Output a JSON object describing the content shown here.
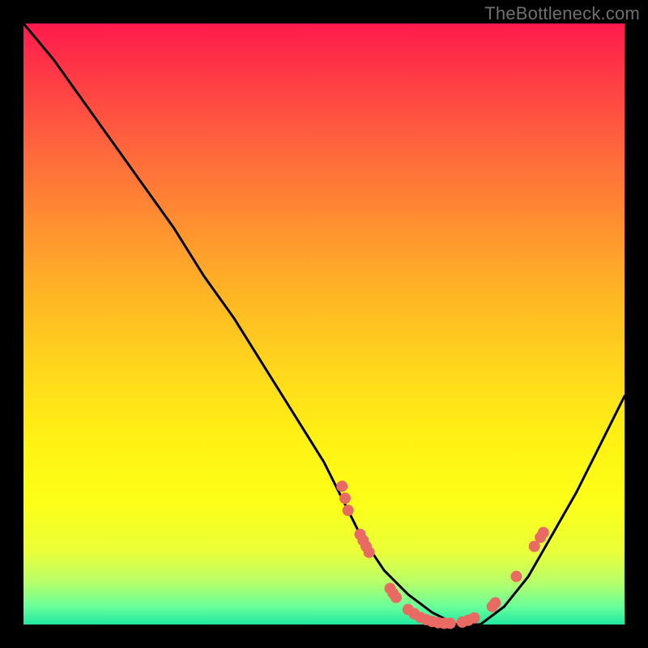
{
  "watermark": "TheBottleneck.com",
  "colors": {
    "background": "#000000",
    "curve": "#000000",
    "marker": "#e96a63",
    "gradient_top": "#ff1a4d",
    "gradient_bottom": "#20e8a0"
  },
  "chart_data": {
    "type": "line",
    "title": "",
    "xlabel": "",
    "ylabel": "",
    "xlim": [
      0,
      100
    ],
    "ylim": [
      0,
      100
    ],
    "x": [
      0,
      5,
      10,
      15,
      20,
      25,
      30,
      35,
      40,
      45,
      50,
      53,
      56,
      60,
      64,
      68,
      72,
      76,
      80,
      84,
      88,
      92,
      96,
      100
    ],
    "values": [
      100,
      94,
      87,
      80,
      73,
      66,
      58,
      51,
      43,
      35,
      27,
      21,
      15,
      9,
      5,
      2,
      0,
      0,
      3,
      8,
      15,
      22,
      30,
      38
    ],
    "notes": "Single V-shaped bottleneck curve on a rainbow gradient plot area.",
    "markers": [
      {
        "x": 53,
        "y": 23
      },
      {
        "x": 53.5,
        "y": 21
      },
      {
        "x": 54,
        "y": 19
      },
      {
        "x": 56,
        "y": 15
      },
      {
        "x": 56.5,
        "y": 14
      },
      {
        "x": 57,
        "y": 13
      },
      {
        "x": 57.5,
        "y": 12
      },
      {
        "x": 61,
        "y": 6
      },
      {
        "x": 61.5,
        "y": 5.2
      },
      {
        "x": 62,
        "y": 4.5
      },
      {
        "x": 64,
        "y": 2.5
      },
      {
        "x": 65,
        "y": 1.8
      },
      {
        "x": 66,
        "y": 1.2
      },
      {
        "x": 67,
        "y": 0.8
      },
      {
        "x": 68,
        "y": 0.5
      },
      {
        "x": 69,
        "y": 0.3
      },
      {
        "x": 70,
        "y": 0.2
      },
      {
        "x": 71,
        "y": 0.2
      },
      {
        "x": 73,
        "y": 0.4
      },
      {
        "x": 74,
        "y": 0.7
      },
      {
        "x": 75,
        "y": 1.1
      },
      {
        "x": 78,
        "y": 3.0
      },
      {
        "x": 78.5,
        "y": 3.6
      },
      {
        "x": 82,
        "y": 8.0
      },
      {
        "x": 85,
        "y": 13.0
      },
      {
        "x": 86,
        "y": 14.5
      },
      {
        "x": 86.5,
        "y": 15.3
      }
    ]
  }
}
